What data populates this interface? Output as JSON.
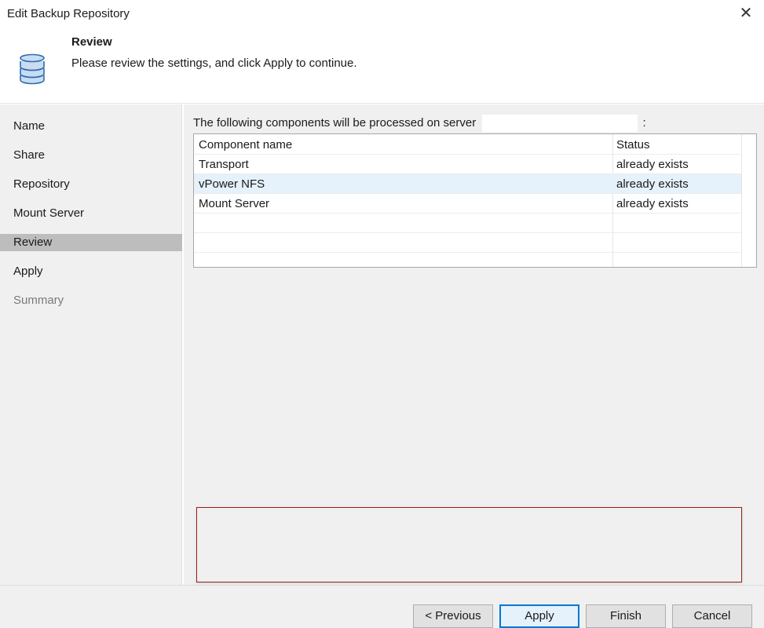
{
  "window": {
    "title": "Edit Backup Repository",
    "close_glyph": "✕"
  },
  "header": {
    "step_title": "Review",
    "step_desc": "Please review the settings, and click Apply to continue.",
    "icon": "database-icon"
  },
  "sidebar": {
    "items": [
      {
        "label": "Name",
        "state": "normal"
      },
      {
        "label": "Share",
        "state": "normal"
      },
      {
        "label": "Repository",
        "state": "normal"
      },
      {
        "label": "Mount Server",
        "state": "normal"
      },
      {
        "label": "Review",
        "state": "active"
      },
      {
        "label": "Apply",
        "state": "normal"
      },
      {
        "label": "Summary",
        "state": "disabled"
      }
    ]
  },
  "main": {
    "intro_text": "The following components will be processed on server",
    "intro_suffix": ":",
    "table": {
      "headers": [
        "Component name",
        "Status"
      ],
      "rows": [
        [
          "Transport",
          "already exists"
        ],
        [
          "vPower NFS",
          "already exists"
        ],
        [
          "Mount Server",
          "already exists"
        ]
      ]
    }
  },
  "footer": {
    "previous_label": "< Previous",
    "apply_label": "Apply",
    "finish_label": "Finish",
    "cancel_label": "Cancel"
  },
  "colors": {
    "accent": "#0078d7",
    "selected_row": "#e5f1fb",
    "active_nav": "#bdbdbd",
    "log_border": "#9b1c1c"
  }
}
